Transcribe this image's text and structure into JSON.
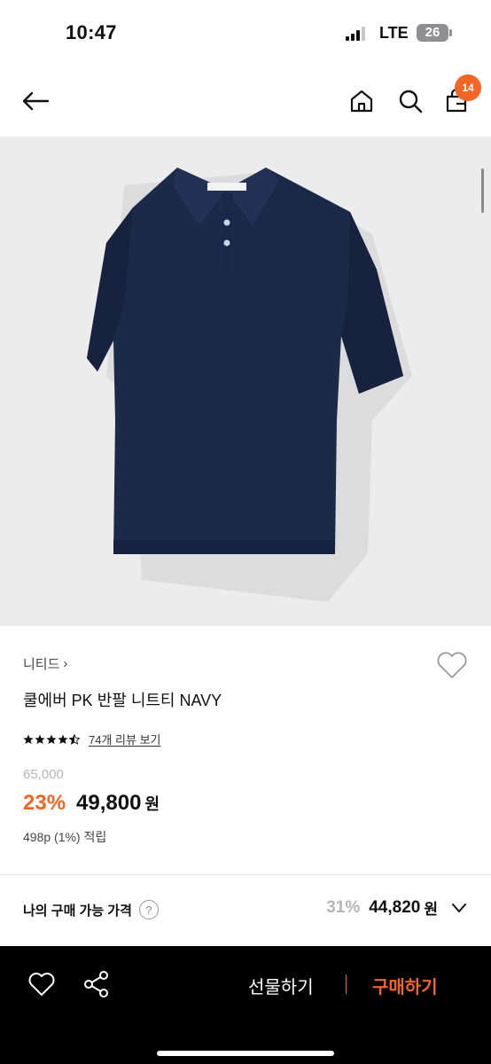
{
  "status_bar": {
    "time": "10:47",
    "network": "LTE",
    "battery": "26"
  },
  "nav": {
    "cart_count": "14",
    "icons": [
      "back-arrow-icon",
      "home-icon",
      "search-icon",
      "cart-icon"
    ]
  },
  "product": {
    "brand": "니티드",
    "brand_chevron": "›",
    "name": "쿨에버 PK 반팔 니트티 NAVY",
    "rating": 4.5,
    "review_link": "74개 리뷰 보기",
    "original_price": "65,000",
    "discount": "23%",
    "sale_price": "49,800",
    "currency": "원",
    "points": "498p (1%) 적립"
  },
  "my_price": {
    "label": "나의 구매 가능 가격",
    "help": "?",
    "discount": "31%",
    "price": "44,820",
    "currency": "원"
  },
  "bottom_bar": {
    "gift_label": "선물하기",
    "buy_label": "구매하기"
  },
  "colors": {
    "accent": "#f26522",
    "image_bg": "#ececec",
    "shirt_navy": "#1c2a4a"
  }
}
